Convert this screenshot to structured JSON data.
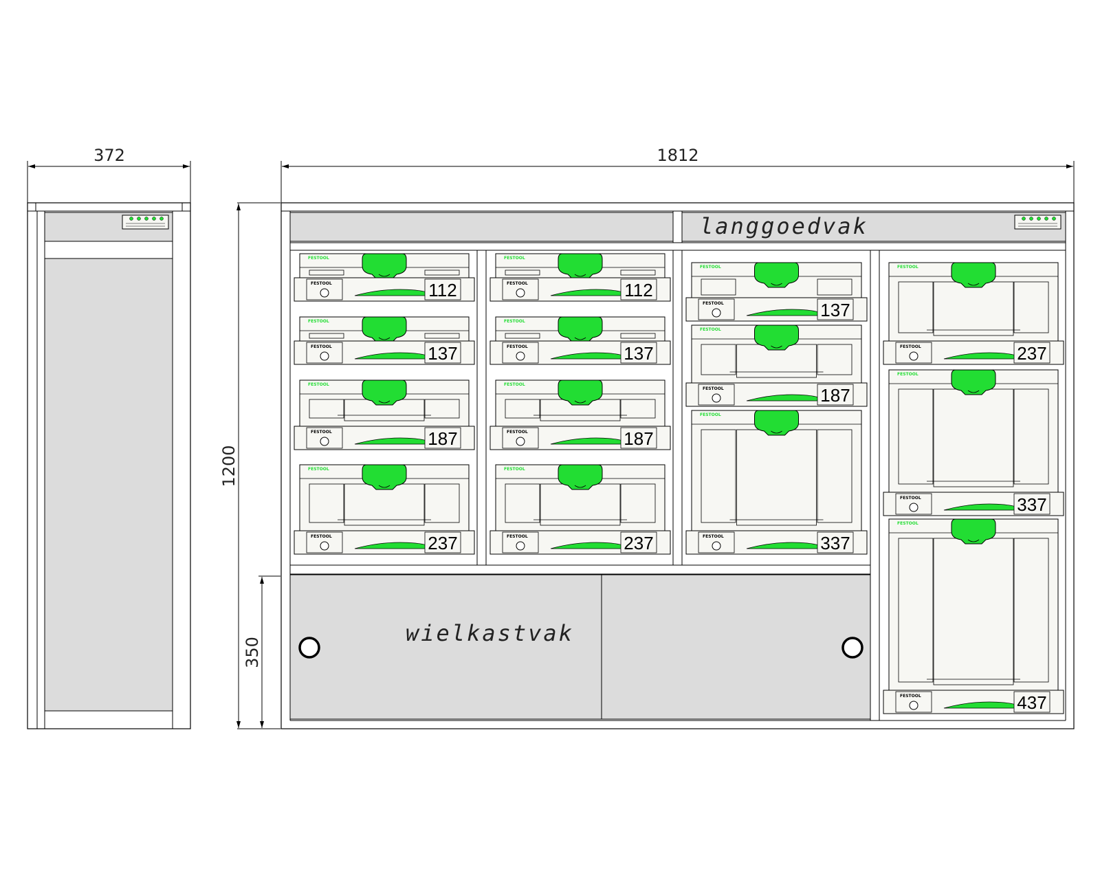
{
  "dimensions": {
    "side_width": "372",
    "front_width": "1812",
    "height": "1200",
    "wheel_height": "350"
  },
  "labels": {
    "long_compartment": "langgoedvak",
    "wheel_compartment": "wielkastvak",
    "systainer_brand": "FESTOOL"
  },
  "columns": [
    {
      "units": [
        "112",
        "137",
        "187",
        "237"
      ]
    },
    {
      "units": [
        "112",
        "137",
        "187",
        "237"
      ]
    },
    {
      "units": [
        "137",
        "187",
        "337"
      ]
    },
    {
      "units": [
        "237",
        "337",
        "437"
      ]
    }
  ],
  "colors": {
    "panel": "#dcdcdc",
    "accent": "#22dd33",
    "line": "#000000",
    "systainer_body": "#f7f7f3"
  }
}
